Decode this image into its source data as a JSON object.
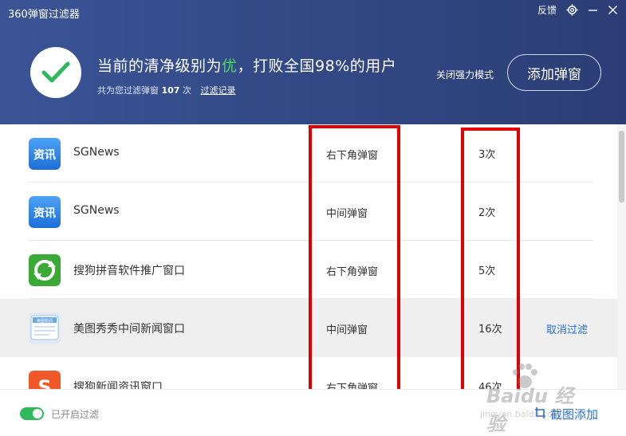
{
  "header": {
    "app_title": "360弹窗过滤器",
    "feedback": "反馈",
    "headline_prefix": "当前的清净级别为",
    "level": "优",
    "headline_suffix": "，打败全国98%的用户",
    "sub_prefix": "共为您过滤弹窗",
    "filtered_count": "107",
    "sub_unit": "次",
    "history_link": "过滤记录",
    "strong_mode": "关闭强力模式",
    "add_button": "添加弹窗"
  },
  "rows": [
    {
      "name": "SGNews",
      "type": "右下角弹窗",
      "count": "3次",
      "action": "",
      "icon": "news-app-icon",
      "icon_text": "资讯"
    },
    {
      "name": "SGNews",
      "type": "中间弹窗",
      "count": "2次",
      "action": "",
      "icon": "news-app-icon",
      "icon_text": "资讯"
    },
    {
      "name": "搜狗拼音软件推广窗口",
      "type": "右下角弹窗",
      "count": "5次",
      "action": "",
      "icon": "sogou-pinyin-icon",
      "icon_text": ""
    },
    {
      "name": "美图秀秀中间新闻窗口",
      "type": "中间弹窗",
      "count": "16次",
      "action": "取消过滤",
      "icon": "meitu-news-icon",
      "icon_text": "美图新闻"
    },
    {
      "name": "搜狗新闻资讯窗口",
      "type": "右下角弹窗",
      "count": "46次",
      "action": "",
      "icon": "sogou-news-icon",
      "icon_text": "S"
    }
  ],
  "footer": {
    "filter_status": "已开启过滤",
    "capture_add": "截图添加"
  },
  "watermark": {
    "brand": "Baidu 经验",
    "url": "jingyan.baidu.com"
  },
  "colors": {
    "header_bg": "#33498a",
    "accent_green": "#4cd964",
    "link_blue": "#2a6fd0",
    "highlight_red": "#e00000"
  }
}
